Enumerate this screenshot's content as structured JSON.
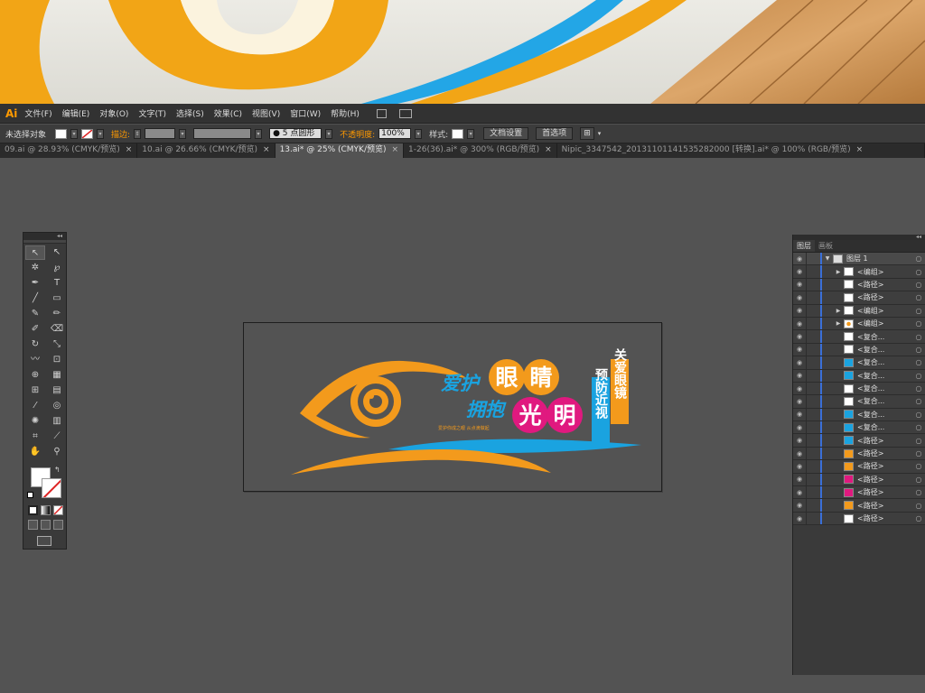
{
  "app": {
    "logo": "Ai"
  },
  "menu": [
    "文件(F)",
    "编辑(E)",
    "对象(O)",
    "文字(T)",
    "选择(S)",
    "效果(C)",
    "视图(V)",
    "窗口(W)",
    "帮助(H)"
  ],
  "control": {
    "selection": "未选择对象",
    "stroke_label": "描边:",
    "brush": "5 点圆形",
    "opacity_label": "不透明度:",
    "opacity": "100%",
    "style_label": "样式:",
    "doc_setup": "文档设置",
    "prefs": "首选项"
  },
  "tabs": [
    {
      "label": "09.ai @ 28.93% (CMYK/预览)",
      "active": false
    },
    {
      "label": "10.ai @ 26.66% (CMYK/预览)",
      "active": false
    },
    {
      "label": "13.ai* @ 25% (CMYK/预览)",
      "active": true
    },
    {
      "label": "1-26(36).ai* @ 300% (RGB/预览)",
      "active": false
    },
    {
      "label": "Nipic_3347542_20131101141535282000 [转换].ai* @ 100% (RGB/预览)",
      "active": false
    }
  ],
  "artwork": {
    "line1_left": "爱护",
    "line1_big": [
      "眼",
      "睛"
    ],
    "line2_left": "拥抱",
    "line2_big": [
      "光",
      "明"
    ],
    "vertical_blue": "预防近视",
    "vertical_orange": "关爱眼镜",
    "small_text": "爱护你成之眼   从点滴做起",
    "colors": {
      "orange": "#f39a1c",
      "blue": "#1aa3e0",
      "magenta": "#e0197f"
    }
  },
  "layers_panel": {
    "tab_layers": "图层",
    "tab_artboards": "画板",
    "layer_name": "图层 1",
    "rows": [
      {
        "label": "<编组>",
        "tri": true,
        "thumb": "white"
      },
      {
        "label": "<路径>",
        "tri": false,
        "thumb": "white"
      },
      {
        "label": "<路径>",
        "tri": false,
        "thumb": "white"
      },
      {
        "label": "<编组>",
        "tri": true,
        "thumb": "white"
      },
      {
        "label": "<编组>",
        "tri": true,
        "thumb": "eye"
      },
      {
        "label": "<复合...",
        "tri": false,
        "thumb": "white"
      },
      {
        "label": "<复合...",
        "tri": false,
        "thumb": "white"
      },
      {
        "label": "<复合...",
        "tri": false,
        "thumb": "blue"
      },
      {
        "label": "<复合...",
        "tri": false,
        "thumb": "blue"
      },
      {
        "label": "<复合...",
        "tri": false,
        "thumb": "white"
      },
      {
        "label": "<复合...",
        "tri": false,
        "thumb": "white"
      },
      {
        "label": "<复合...",
        "tri": false,
        "thumb": "blue"
      },
      {
        "label": "<复合...",
        "tri": false,
        "thumb": "blue"
      },
      {
        "label": "<路径>",
        "tri": false,
        "thumb": "blue"
      },
      {
        "label": "<路径>",
        "tri": false,
        "thumb": "orange"
      },
      {
        "label": "<路径>",
        "tri": false,
        "thumb": "orange"
      },
      {
        "label": "<路径>",
        "tri": false,
        "thumb": "magenta"
      },
      {
        "label": "<路径>",
        "tri": false,
        "thumb": "magenta"
      },
      {
        "label": "<路径>",
        "tri": false,
        "thumb": "orange"
      },
      {
        "label": "<路径>",
        "tri": false,
        "thumb": "white"
      }
    ]
  }
}
